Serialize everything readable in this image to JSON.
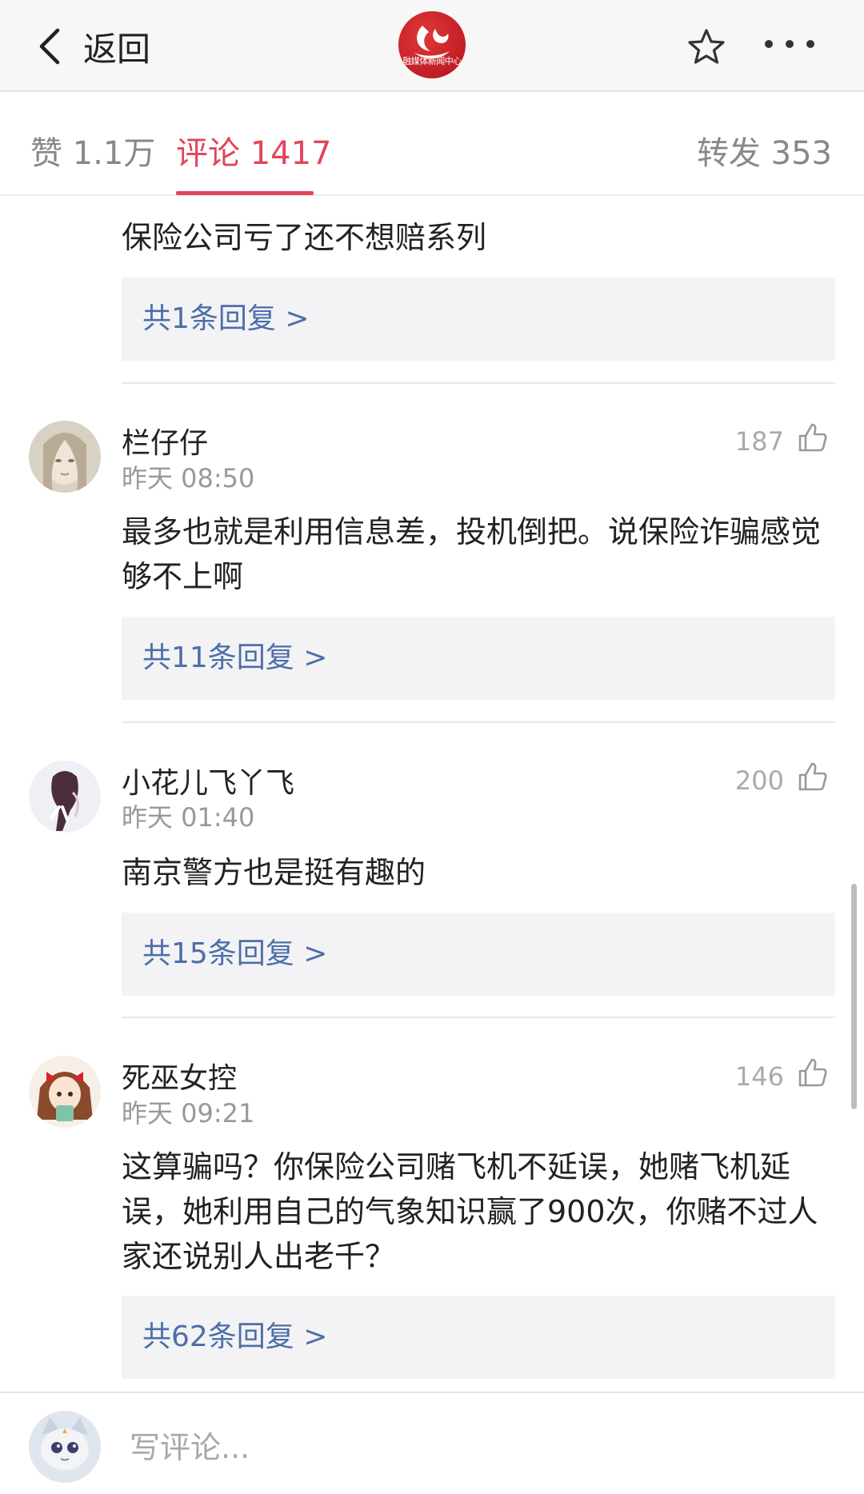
{
  "header": {
    "back_label": "返回",
    "logo_text": "融媒体新闻中心"
  },
  "tabs": {
    "likes": "赞 1.1万",
    "comments": "评论 1417",
    "reposts": "转发 353",
    "active": "comments",
    "accent_color": "#e0465a"
  },
  "comments": [
    {
      "text": "保险公司亏了还不想赔系列",
      "reply_link": "共1条回复 >"
    },
    {
      "user": "栏仔仔",
      "time": "昨天 08:50",
      "likes": "187",
      "text": "最多也就是利用信息差，投机倒把。说保险诈骗感觉够不上啊",
      "reply_link": "共11条回复 >"
    },
    {
      "user": "小花儿飞丫飞",
      "time": "昨天 01:40",
      "likes": "200",
      "text": "南京警方也是挺有趣的",
      "reply_link": "共15条回复 >"
    },
    {
      "user": "死巫女控",
      "time": "昨天 09:21",
      "likes": "146",
      "text": "这算骗吗？你保险公司赌飞机不延误，她赌飞机延误，她利用自己的气象知识赢了900次，你赌不过人家还说别人出老千？",
      "reply_link": "共62条回复 >"
    }
  ],
  "compose": {
    "placeholder": "写评论..."
  },
  "icons": {
    "back": "chevron-left-icon",
    "star": "star-icon",
    "more": "more-dots-icon",
    "like": "thumbs-up-icon"
  }
}
